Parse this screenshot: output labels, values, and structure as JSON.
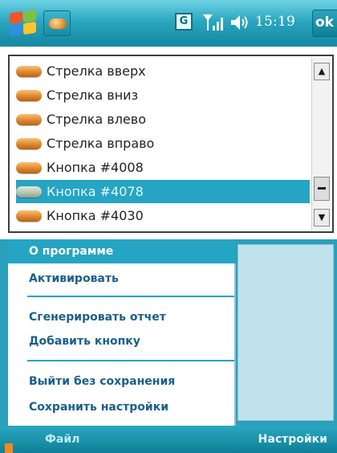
{
  "status_bar": {
    "time": "15:19",
    "ok_label": "ok",
    "keyboard_glyph": "G",
    "icons": [
      "windows-start-icon",
      "app-icon",
      "keyboard-icon",
      "signal-icon",
      "volume-icon"
    ]
  },
  "list": {
    "items": [
      {
        "label": "Стрелка вверх",
        "selected": false
      },
      {
        "label": "Стрелка вниз",
        "selected": false
      },
      {
        "label": "Стрелка влево",
        "selected": false
      },
      {
        "label": "Стрелка вправо",
        "selected": false
      },
      {
        "label": "Кнопка #4008",
        "selected": false
      },
      {
        "label": "Кнопка #4078",
        "selected": true
      },
      {
        "label": "Кнопка #4030",
        "selected": false
      }
    ],
    "scroll_up_glyph": "▲",
    "scroll_down_glyph": "▼"
  },
  "menu": {
    "items": [
      {
        "label": "О программе",
        "highlighted": true
      },
      {
        "label": "Активировать",
        "highlighted": false
      },
      {
        "label": "Сгенерировать отчет",
        "highlighted": false
      },
      {
        "label": "Добавить кнопку",
        "highlighted": false
      },
      {
        "label": "Выйти без сохранения",
        "highlighted": false
      },
      {
        "label": "Сохранить настройки",
        "highlighted": false
      }
    ]
  },
  "softkeys": {
    "left": "Файл",
    "right": "Настройки"
  },
  "colors": {
    "accent": "#25a5c3",
    "menu_text": "#1a5f8a",
    "item_icon": "#e0872a"
  }
}
